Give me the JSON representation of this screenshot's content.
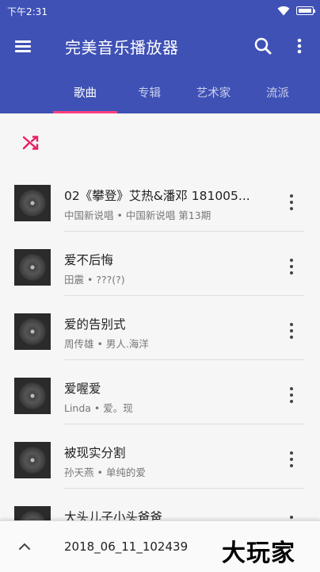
{
  "status": {
    "time": "下午2:31"
  },
  "toolbar": {
    "title": "完美音乐播放器"
  },
  "tabs": [
    {
      "label": "歌曲",
      "active": true
    },
    {
      "label": "专辑",
      "active": false
    },
    {
      "label": "艺术家",
      "active": false
    },
    {
      "label": "流派",
      "active": false
    }
  ],
  "colors": {
    "primary": "#3f51b5",
    "accent": "#ff4081"
  },
  "icons": {
    "menu": "menu-icon",
    "search": "search-icon",
    "more": "more-vert-icon",
    "shuffle": "shuffle-icon",
    "expand": "chevron-up-icon"
  },
  "songs": [
    {
      "title": "02《攀登》艾热&潘邓 181005...",
      "subtitle": "中国新说唱 • 中国新说唱 第13期"
    },
    {
      "title": "爱不后悔",
      "subtitle": "田震 • ???(?)"
    },
    {
      "title": "爱的告别式",
      "subtitle": "周传雄 • 男人.海洋"
    },
    {
      "title": "爱喔爱",
      "subtitle": "Linda • 爱。现"
    },
    {
      "title": "被现实分割",
      "subtitle": "孙天燕 • 单纯的爱"
    },
    {
      "title": "大头儿子小头爸爸",
      "subtitle": ""
    }
  ],
  "mini_player": {
    "title": "2018_06_11_102439"
  },
  "watermark": "大玩家"
}
